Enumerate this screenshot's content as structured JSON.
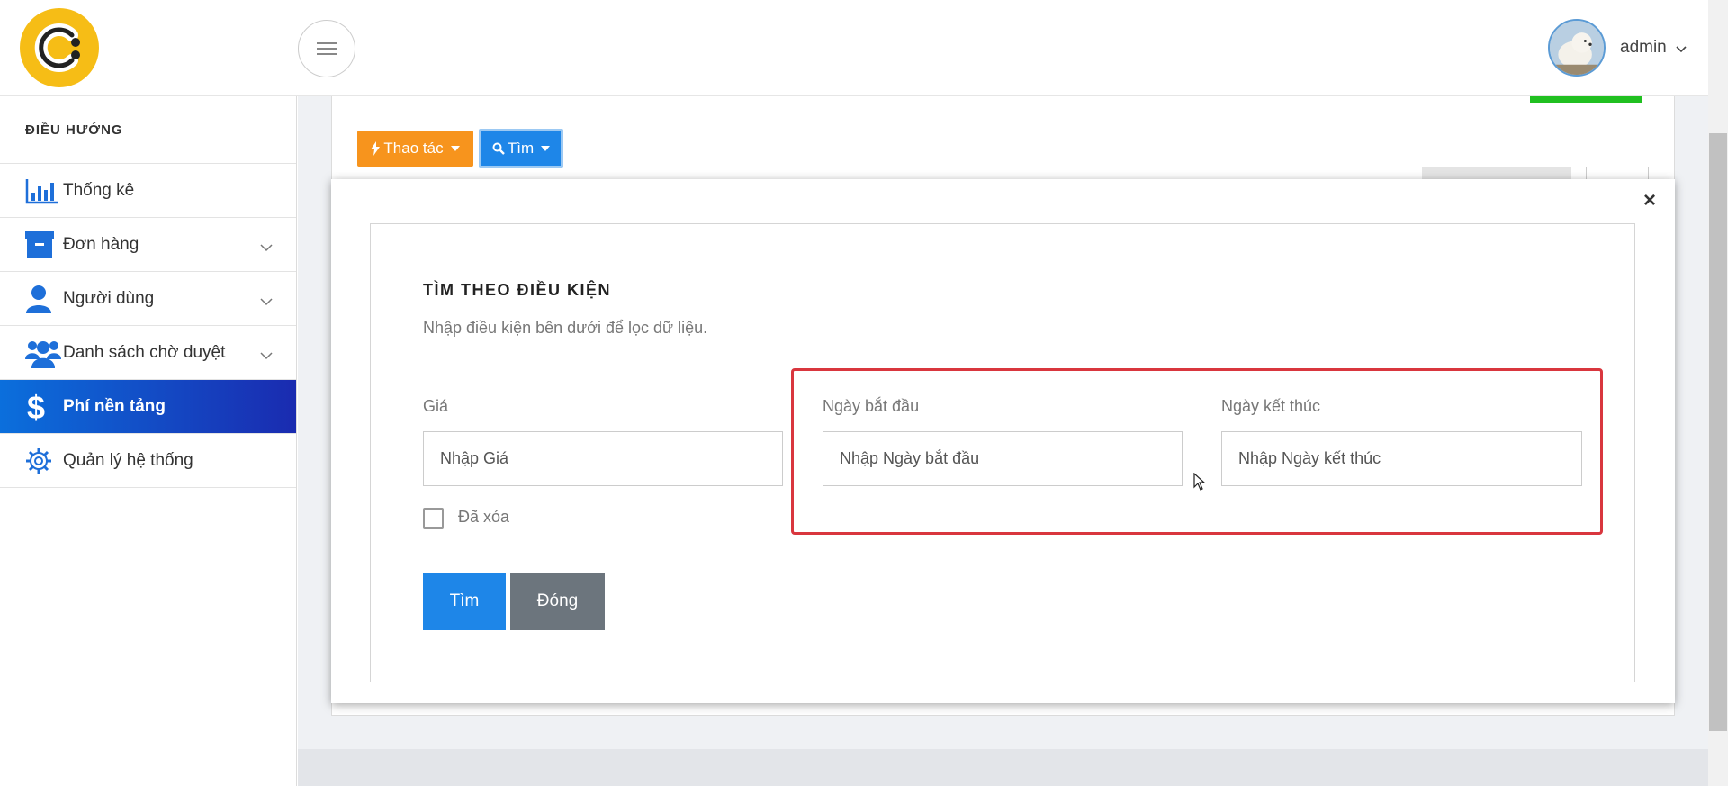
{
  "header": {
    "user_name": "admin",
    "colors": {
      "logo": "#f6bd16",
      "avatar_ring": "#5b9bd5"
    }
  },
  "sidebar": {
    "heading": "ĐIỀU HƯỚNG",
    "items": [
      {
        "label": "Thống kê",
        "icon": "bar-chart-icon",
        "expandable": false
      },
      {
        "label": "Đơn hàng",
        "icon": "archive-box-icon",
        "expandable": true
      },
      {
        "label": "Người dùng",
        "icon": "user-icon",
        "expandable": true
      },
      {
        "label": "Danh sách chờ duyệt",
        "icon": "users-group-icon",
        "expandable": true
      },
      {
        "label": "Phí nền tảng",
        "icon": "dollar-icon",
        "expandable": false,
        "active": true
      },
      {
        "label": "Quản lý hệ thống",
        "icon": "gear-icon",
        "expandable": false
      }
    ]
  },
  "toolbar": {
    "actions_label": "Thao tác",
    "search_label": "Tìm",
    "colors": {
      "actions": "#f7941d",
      "search": "#1e86e8"
    }
  },
  "search_panel": {
    "title": "TÌM THEO ĐIỀU KIỆN",
    "subtitle": "Nhập điều kiện bên dưới để lọc dữ liệu.",
    "fields": {
      "price": {
        "label": "Giá",
        "placeholder": "Nhập Giá",
        "value": ""
      },
      "start_date": {
        "label": "Ngày bắt đầu",
        "placeholder": "Nhập Ngày bắt đầu",
        "value": ""
      },
      "end_date": {
        "label": "Ngày kết thúc",
        "placeholder": "Nhập Ngày kết thúc",
        "value": ""
      }
    },
    "deleted_checkbox": {
      "label": "Đã xóa",
      "checked": false
    },
    "submit_label": "Tìm",
    "close_label": "Đóng",
    "close_icon": "×",
    "colors": {
      "submit": "#1e86e8",
      "close": "#6c757d",
      "highlight": "#d9363e"
    }
  }
}
